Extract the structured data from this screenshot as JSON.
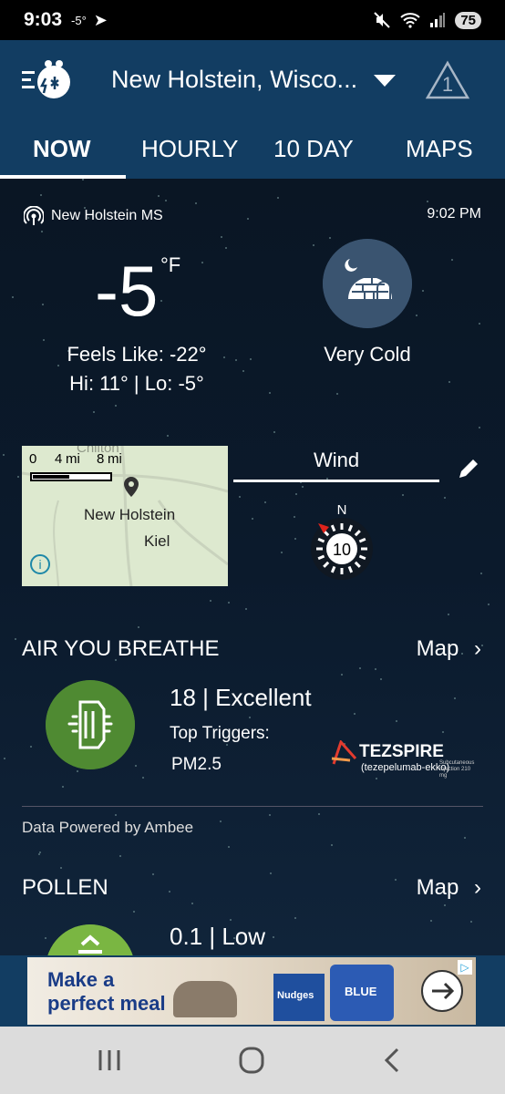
{
  "status_bar": {
    "time": "9:03",
    "temp": "-5°",
    "battery": "75"
  },
  "header": {
    "location": "New Holstein, Wisco...",
    "alert_count": "1"
  },
  "tabs": [
    {
      "label": "NOW"
    },
    {
      "label": "HOURLY"
    },
    {
      "label": "10 DAY"
    },
    {
      "label": "MAPS"
    }
  ],
  "current": {
    "station": "New Holstein MS",
    "observed_time": "9:02 PM",
    "temp": "-5",
    "unit": "°F",
    "feels_like": "Feels Like: -22°",
    "hi_lo": "Hi: 11° | Lo: -5°",
    "condition": "Very Cold"
  },
  "mini_map": {
    "scale_0": "0",
    "scale_4": "4",
    "scale_mi": "mi",
    "scale_8": "8",
    "scale_mi2": "mi",
    "label_ghost": "Chilton",
    "town": "New Holstein",
    "town2": "Kiel"
  },
  "wind": {
    "title": "Wind",
    "speed": "10",
    "direction_letter": "N"
  },
  "air": {
    "title": "AIR YOU BREATHE",
    "link": "Map",
    "value": "18 | Excellent",
    "triggers_label": "Top Triggers:",
    "trigger": "PM2.5",
    "sponsor": "TEZSPIRE",
    "sponsor_sub": "(tezepelumab-ekko)",
    "sponsor_note": "Subcutaneous Injection 210 mg",
    "powered_by": "Data Powered by Ambee"
  },
  "pollen": {
    "title": "POLLEN",
    "link": "Map",
    "value": "0.1 | Low"
  },
  "ad": {
    "line1": "Make a",
    "line2": "perfect meal",
    "brand1": "Nudges",
    "brand2": "BLUE"
  },
  "colors": {
    "header_bg": "#123d62",
    "air_green": "#4f8a32",
    "pollen_green": "#7ab642"
  }
}
